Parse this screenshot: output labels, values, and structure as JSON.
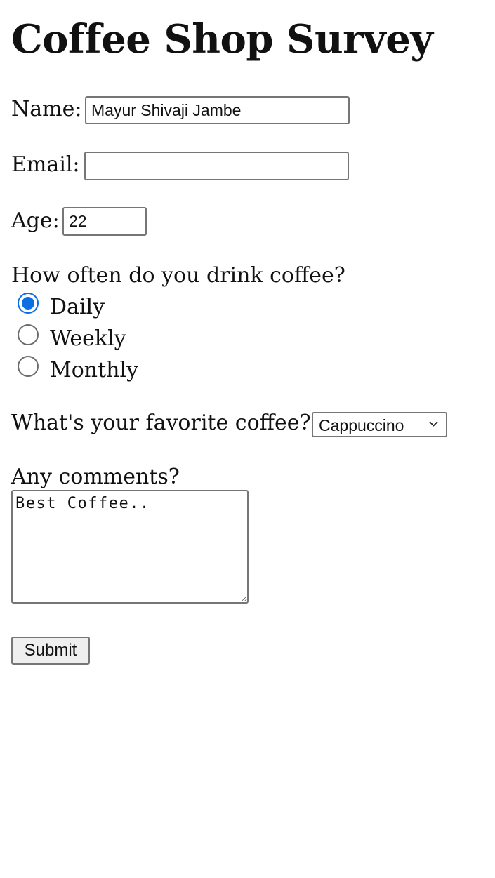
{
  "title": "Coffee Shop Survey",
  "form": {
    "name": {
      "label": "Name:",
      "value": "Mayur Shivaji Jambe",
      "placeholder": ""
    },
    "email": {
      "label": "Email:",
      "value": "",
      "placeholder": ""
    },
    "age": {
      "label": "Age:",
      "value": "22"
    },
    "frequency": {
      "question": "How often do you drink coffee?",
      "options": [
        {
          "label": "Daily",
          "checked": true
        },
        {
          "label": "Weekly",
          "checked": false
        },
        {
          "label": "Monthly",
          "checked": false
        }
      ]
    },
    "favorite": {
      "question": "What's your favorite coffee?",
      "selected": "Cappuccino"
    },
    "comments": {
      "label": "Any comments?",
      "value": "Best Coffee.."
    },
    "submit_label": "Submit"
  },
  "colors": {
    "radio_checked": "#0b6fe4",
    "input_border": "#767676",
    "button_background": "#efefef"
  },
  "icons": {
    "select_arrow": "chevron-down-icon"
  }
}
